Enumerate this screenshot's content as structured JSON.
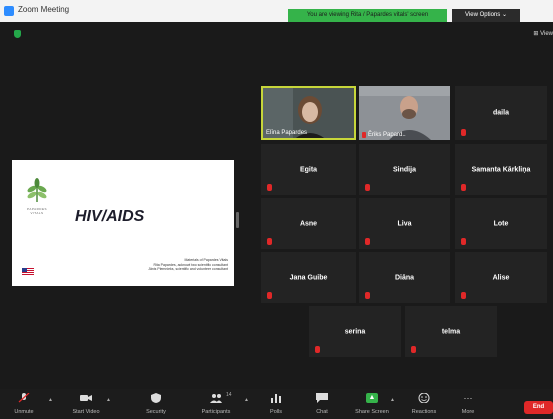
{
  "window": {
    "title": "Zoom Meeting",
    "share_banner": "You are viewing Rita / Papardes vitals' screen",
    "view_options": "View Options ⌄",
    "view_corner": "View"
  },
  "slide": {
    "logo_text": "PAPARDES VITALS",
    "title": "HIV/AIDS",
    "credits": [
      "Materials of Papardes Vitals",
      "Rita Papardes, acknowl two scientific consultant",
      "Jānis Plemnieks, scientific and volunteer consultant"
    ]
  },
  "participants": {
    "video": [
      {
        "name": "Elīna Papardes",
        "speaking": true
      },
      {
        "name": "Ēriks Papard..",
        "speaking": false
      }
    ],
    "tiles": [
      {
        "name": "daila"
      },
      {
        "name": "Egita"
      },
      {
        "name": "Sindija"
      },
      {
        "name": "Samanta Kārkliņa"
      },
      {
        "name": "Asne"
      },
      {
        "name": "Liva"
      },
      {
        "name": "Lote"
      },
      {
        "name": "Jana Guibe"
      },
      {
        "name": "Diāna"
      },
      {
        "name": "Alise"
      },
      {
        "name": "serina"
      },
      {
        "name": "telma"
      }
    ]
  },
  "toolbar": {
    "unmute": "Unmute",
    "start_video": "Start Video",
    "security": "Security",
    "participants": "Participants",
    "participants_count": "14",
    "polls": "Polls",
    "chat": "Chat",
    "share_screen": "Share Screen",
    "reactions": "Reactions",
    "more": "More",
    "more_icon": "···",
    "end": "End"
  },
  "colors": {
    "share_green": "#35b34a",
    "speaker_border": "#c7d63a",
    "mute_red": "#e02828",
    "end_red": "#e02828",
    "tile_bg": "#232323"
  }
}
